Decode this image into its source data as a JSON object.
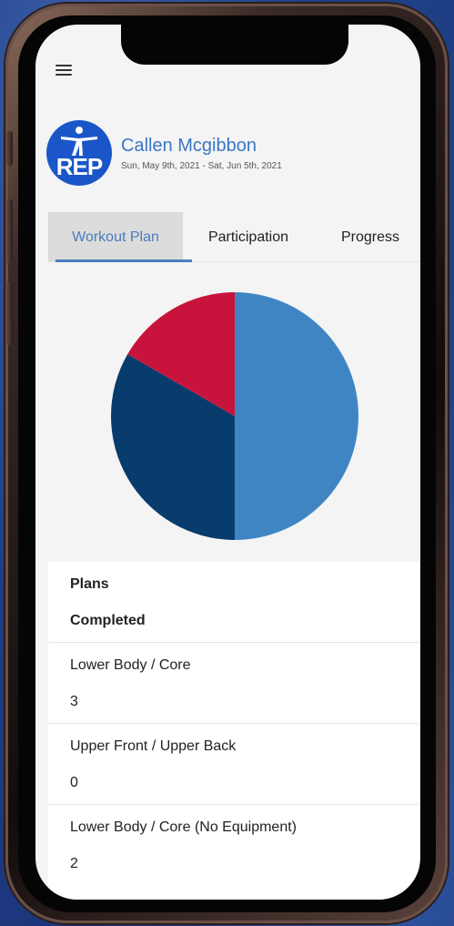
{
  "user": {
    "name": "Callen Mcgibbon",
    "date_range": "Sun, May 9th, 2021 - Sat, Jun 5th, 2021"
  },
  "logo": {
    "text": "REP"
  },
  "tabs": [
    {
      "label": "Workout Plan",
      "active": true
    },
    {
      "label": "Participation",
      "active": false
    },
    {
      "label": "Progress",
      "active": false
    }
  ],
  "chart_data": {
    "type": "pie",
    "values": [
      3,
      2,
      1
    ],
    "colors": [
      "#3f85c4",
      "#083c6c",
      "#c8143d"
    ]
  },
  "table": {
    "header": {
      "title": "Plans",
      "subtitle": "Completed"
    },
    "rows": [
      {
        "plan": "Lower Body / Core",
        "completed": "3"
      },
      {
        "plan": "Upper Front / Upper Back",
        "completed": "0"
      },
      {
        "plan": "Lower Body / Core (No Equipment)",
        "completed": "2"
      }
    ]
  },
  "icons": {
    "menu": "hamburger-menu-icon"
  },
  "colors": {
    "accent": "#4a7fc0",
    "name": "#3a77c4"
  }
}
